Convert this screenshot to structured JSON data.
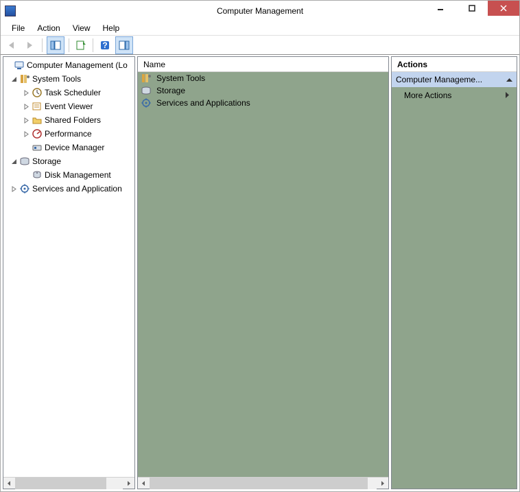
{
  "window": {
    "title": "Computer Management"
  },
  "menubar": {
    "items": [
      "File",
      "Action",
      "View",
      "Help"
    ]
  },
  "tree": [
    {
      "label": "Computer Management (Lo",
      "icon": "computer-mgmt",
      "indent": 0,
      "expander": "none"
    },
    {
      "label": "System Tools",
      "icon": "system-tools",
      "indent": 1,
      "expander": "open"
    },
    {
      "label": "Task Scheduler",
      "icon": "task-scheduler",
      "indent": 2,
      "expander": "closed"
    },
    {
      "label": "Event Viewer",
      "icon": "event-viewer",
      "indent": 2,
      "expander": "closed"
    },
    {
      "label": "Shared Folders",
      "icon": "shared-folders",
      "indent": 2,
      "expander": "closed"
    },
    {
      "label": "Performance",
      "icon": "performance",
      "indent": 2,
      "expander": "closed"
    },
    {
      "label": "Device Manager",
      "icon": "device-manager",
      "indent": 2,
      "expander": "none"
    },
    {
      "label": "Storage",
      "icon": "storage",
      "indent": 1,
      "expander": "open"
    },
    {
      "label": "Disk Management",
      "icon": "disk-mgmt",
      "indent": 2,
      "expander": "none"
    },
    {
      "label": "Services and Application",
      "icon": "services",
      "indent": 1,
      "expander": "closed"
    }
  ],
  "center": {
    "header": "Name",
    "items": [
      {
        "label": "System Tools",
        "icon": "system-tools"
      },
      {
        "label": "Storage",
        "icon": "storage"
      },
      {
        "label": "Services and Applications",
        "icon": "services"
      }
    ]
  },
  "actions": {
    "header": "Actions",
    "section_title": "Computer Manageme...",
    "items": [
      {
        "label": "More Actions"
      }
    ]
  }
}
